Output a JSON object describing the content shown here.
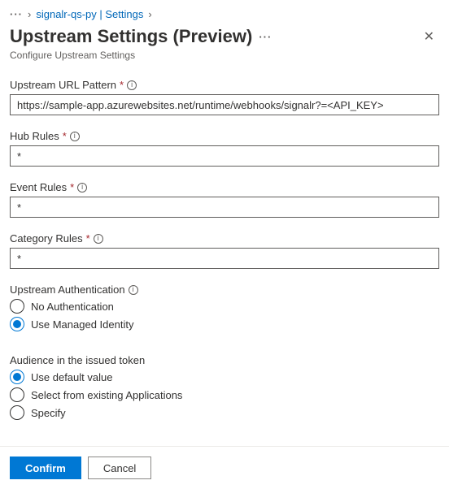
{
  "breadcrumb": {
    "item1": "signalr-qs-py | Settings"
  },
  "header": {
    "title": "Upstream Settings (Preview)",
    "subtitle": "Configure Upstream Settings"
  },
  "fields": {
    "url_pattern": {
      "label": "Upstream URL Pattern",
      "value": "https://sample-app.azurewebsites.net/runtime/webhooks/signalr?=<API_KEY>"
    },
    "hub_rules": {
      "label": "Hub Rules",
      "value": "*"
    },
    "event_rules": {
      "label": "Event Rules",
      "value": "*"
    },
    "category_rules": {
      "label": "Category Rules",
      "value": "*"
    }
  },
  "auth": {
    "label": "Upstream Authentication",
    "options": {
      "none": "No Authentication",
      "managed": "Use Managed Identity"
    }
  },
  "audience": {
    "label": "Audience in the issued token",
    "options": {
      "default": "Use default value",
      "existing": "Select from existing Applications",
      "specify": "Specify"
    }
  },
  "footer": {
    "confirm": "Confirm",
    "cancel": "Cancel"
  }
}
